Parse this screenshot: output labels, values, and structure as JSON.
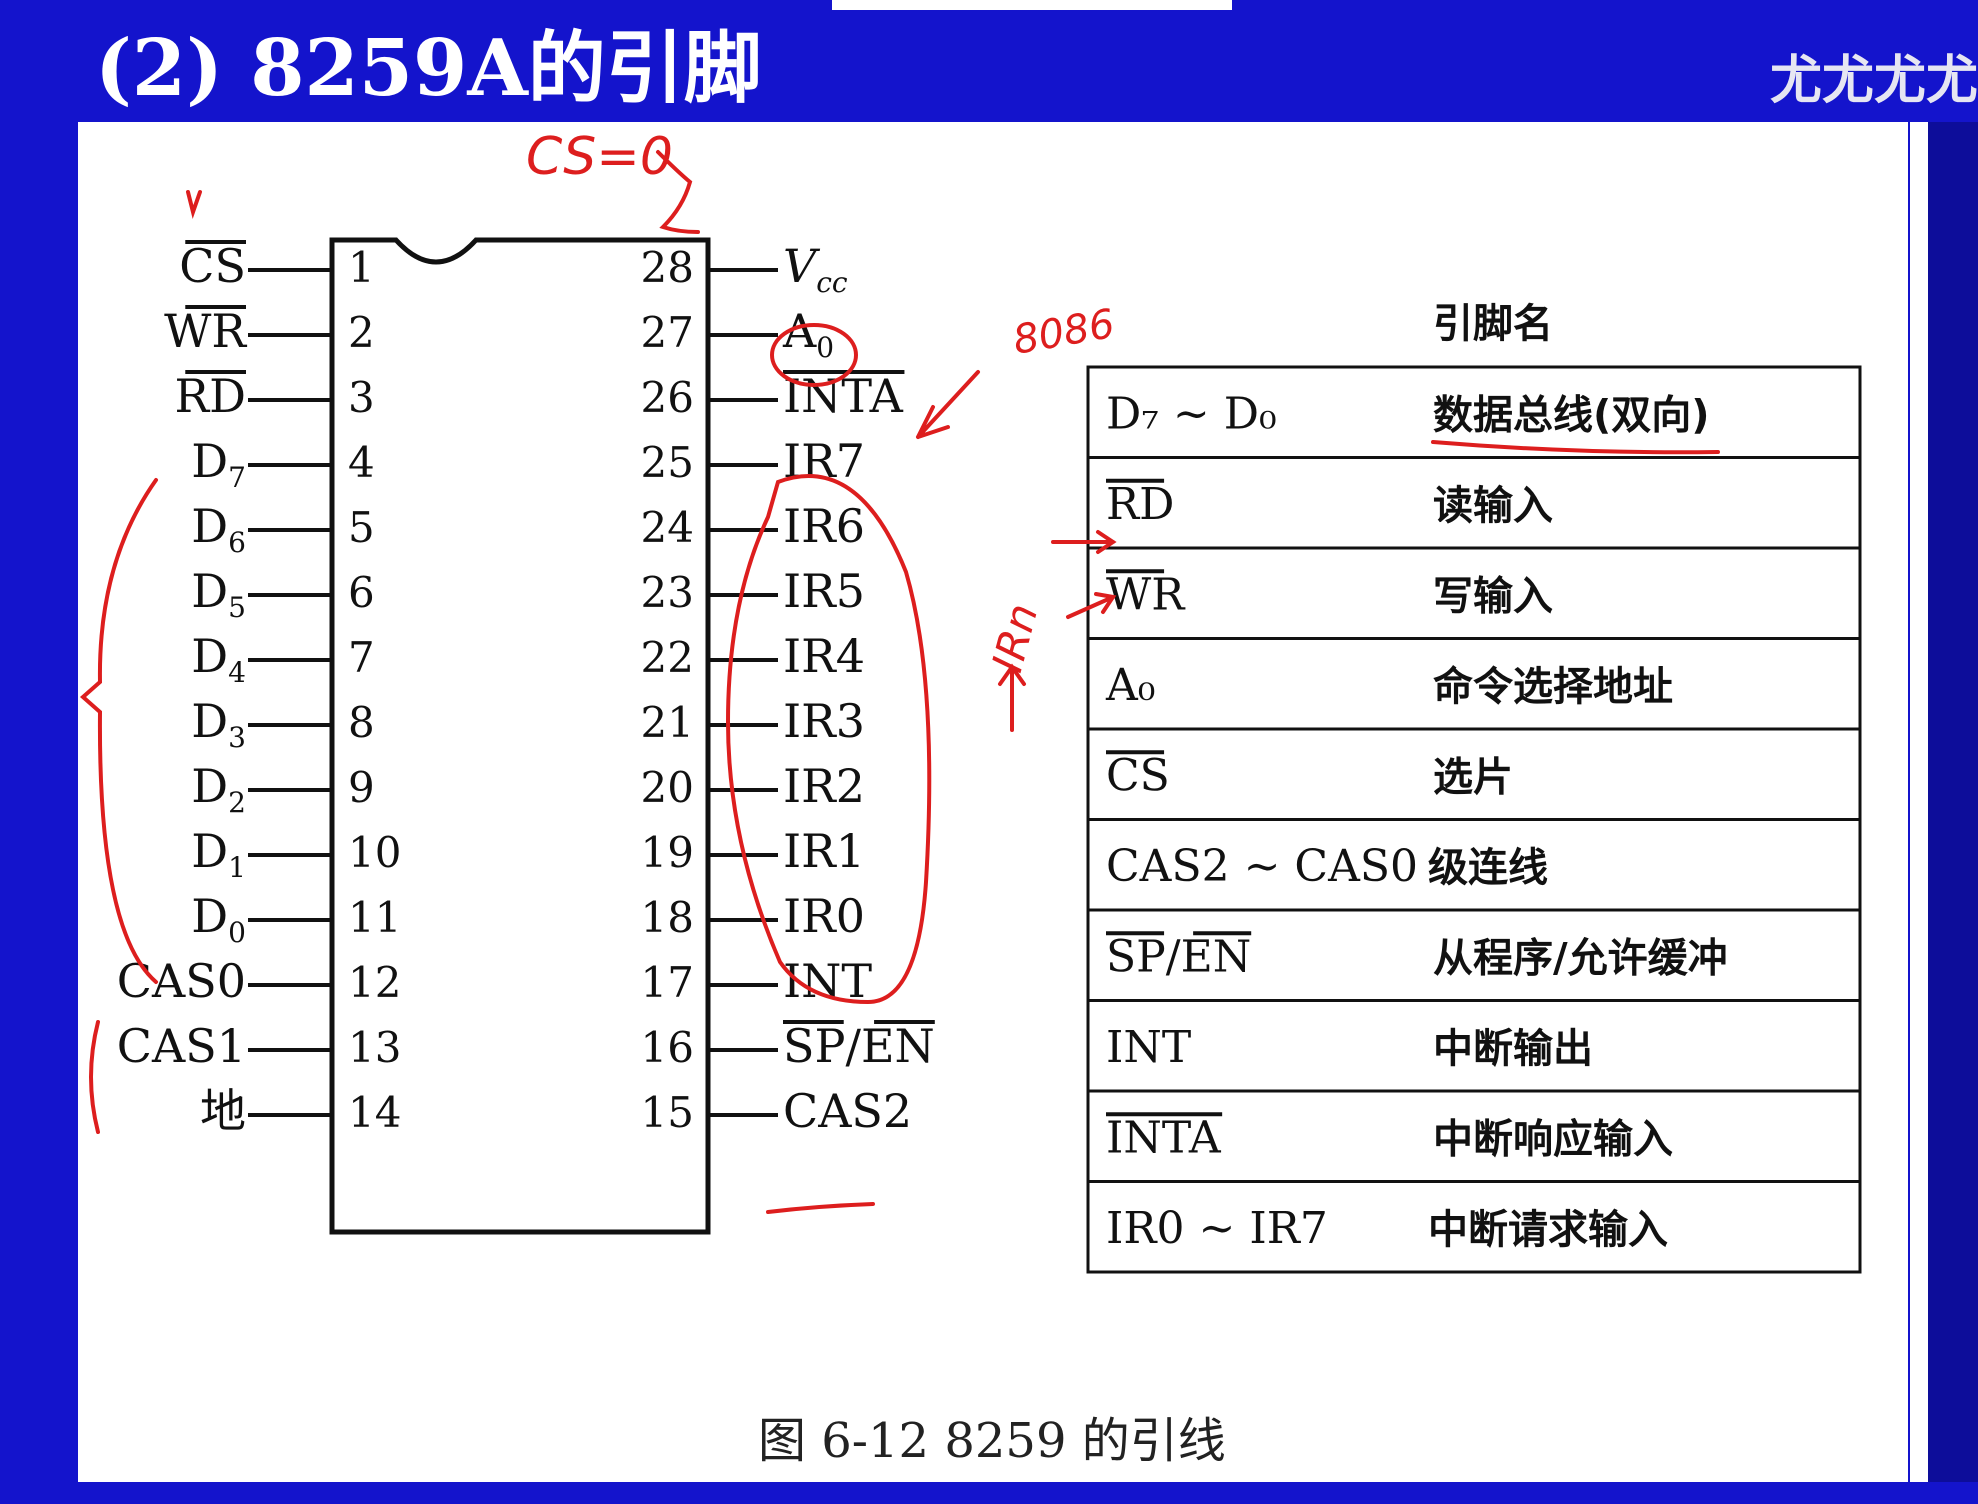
{
  "slide": {
    "title": "(2) 8259A的引脚",
    "watermark": "尤尤尤尤"
  },
  "chip": {
    "left_pins": [
      {
        "num": "1",
        "name": "CS",
        "overbar": true
      },
      {
        "num": "2",
        "name": "WR",
        "overbar": true
      },
      {
        "num": "3",
        "name": "RD",
        "overbar": true
      },
      {
        "num": "4",
        "name": "D",
        "sub": "7",
        "overbar": false
      },
      {
        "num": "5",
        "name": "D",
        "sub": "6",
        "overbar": false
      },
      {
        "num": "6",
        "name": "D",
        "sub": "5",
        "overbar": false
      },
      {
        "num": "7",
        "name": "D",
        "sub": "4",
        "overbar": false
      },
      {
        "num": "8",
        "name": "D",
        "sub": "3",
        "overbar": false
      },
      {
        "num": "9",
        "name": "D",
        "sub": "2",
        "overbar": false
      },
      {
        "num": "10",
        "name": "D",
        "sub": "1",
        "overbar": false
      },
      {
        "num": "11",
        "name": "D",
        "sub": "0",
        "overbar": false
      },
      {
        "num": "12",
        "name": "CAS0",
        "overbar": false
      },
      {
        "num": "13",
        "name": "CAS1",
        "overbar": false
      },
      {
        "num": "14",
        "name": "地",
        "overbar": false
      }
    ],
    "right_pins": [
      {
        "num": "28",
        "name": "V",
        "sub": "cc",
        "overbar": false,
        "italic": true
      },
      {
        "num": "27",
        "name": "A",
        "sub": "0",
        "overbar": false
      },
      {
        "num": "26",
        "name": "INTA",
        "overbar": true
      },
      {
        "num": "25",
        "name": "IR7",
        "overbar": false
      },
      {
        "num": "24",
        "name": "IR6",
        "overbar": false
      },
      {
        "num": "23",
        "name": "IR5",
        "overbar": false
      },
      {
        "num": "22",
        "name": "IR4",
        "overbar": false
      },
      {
        "num": "21",
        "name": "IR3",
        "overbar": false
      },
      {
        "num": "20",
        "name": "IR2",
        "overbar": false
      },
      {
        "num": "19",
        "name": "IR1",
        "overbar": false
      },
      {
        "num": "18",
        "name": "IR0",
        "overbar": false
      },
      {
        "num": "17",
        "name": "INT",
        "overbar": false
      },
      {
        "num": "16",
        "name": "SP/EN",
        "overbar": "both"
      },
      {
        "num": "15",
        "name": "CAS2",
        "overbar": false
      }
    ]
  },
  "pin_table": {
    "header": "引脚名",
    "rows": [
      {
        "pin": "D",
        "pin_extra": "₇ ~ D₀",
        "desc": "数据总线(双向)",
        "overbar": false
      },
      {
        "pin": "RD",
        "desc": "读输入",
        "overbar": true
      },
      {
        "pin": "WR",
        "desc": "写输入",
        "overbar": true
      },
      {
        "pin": "A₀",
        "desc": "命令选择地址",
        "overbar": false
      },
      {
        "pin": "CS",
        "desc": "选片",
        "overbar": true
      },
      {
        "pin": "CAS2 ~ CAS0",
        "desc": "级连线",
        "overbar": false
      },
      {
        "pin": "SP/EN",
        "desc": "从程序/允许缓冲",
        "overbar": "both"
      },
      {
        "pin": "INT",
        "desc": "中断输出",
        "overbar": false
      },
      {
        "pin": "INTA",
        "desc": "中断响应输入",
        "overbar": true
      },
      {
        "pin": "IR0 ~ IR7",
        "desc": "中断请求输入",
        "overbar": false
      }
    ]
  },
  "caption": "图 6-12   8259 的引线",
  "annotations": {
    "cs_note": "CS=0",
    "cpu_note": "8086",
    "ir_note": "IRn",
    "color": "#dd1e1e"
  }
}
